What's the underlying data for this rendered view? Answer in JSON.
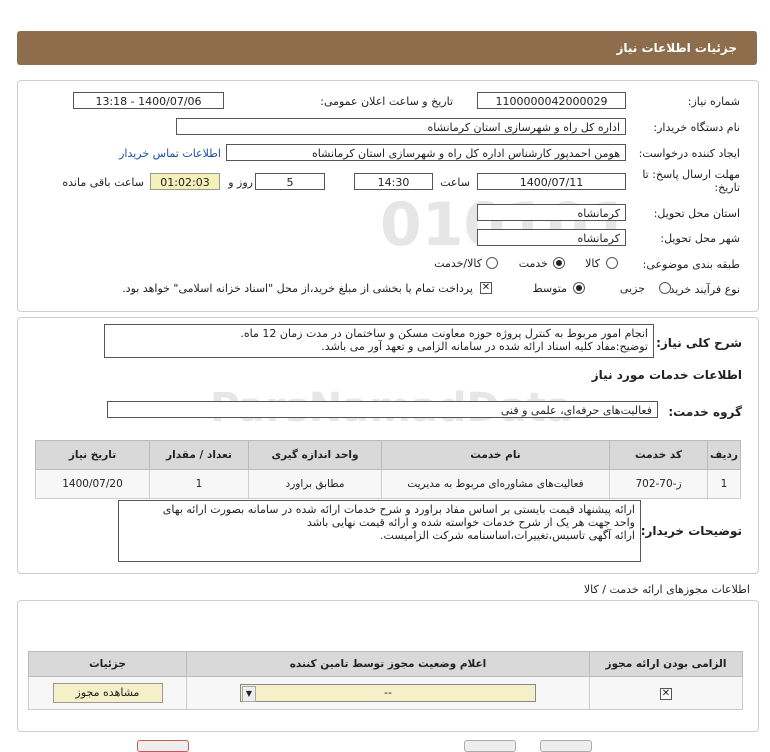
{
  "header": {
    "title": "جزئیات اطلاعات نیاز"
  },
  "form": {
    "need_number_label": "شماره نیاز:",
    "need_number": "1100000042000029",
    "announce_label": "تاریخ و ساعت اعلان عمومی:",
    "announce_value": "1400/07/06 - 13:18",
    "buyer_org_label": "نام دستگاه خریدار:",
    "buyer_org": "اداره کل راه و شهرسازی استان کرمانشاه",
    "creator_label": "ایجاد کننده درخواست:",
    "creator": "هومن احمدپور کارشناس اداره کل راه و شهرسازی استان کرمانشاه",
    "contact_link": "اطلاعات تماس خریدار",
    "deadline_label_1": "مهلت ارسال پاسخ: تا",
    "deadline_label_2": "تاریخ:",
    "deadline_date": "1400/07/11",
    "time_label": "ساعت",
    "deadline_time": "14:30",
    "days_value": "5",
    "days_label": "روز و",
    "remaining_time": "01:02:03",
    "remaining_label": "ساعت باقی مانده",
    "province_label": "استان محل تحویل:",
    "province": "کرمانشاه",
    "city_label": "شهر محل تحویل:",
    "city": "کرمانشاه",
    "category_label": "طبقه بندی موضوعی:",
    "category_options": [
      "کالا",
      "خدمت",
      "کالا/خدمت"
    ],
    "category_selected": "خدمت",
    "process_label": "نوع فرآیند خرید :",
    "process_options": [
      "جزیی",
      "متوسط"
    ],
    "process_selected": "متوسط",
    "payment_note": "پرداخت تمام یا بخشی از مبلغ خرید،از محل \"اسناد خزانه اسلامی\" خواهد بود."
  },
  "summary": {
    "label": "شرح کلی نیاز:",
    "line1": "انجام امور مربوط به کنترل پروژه حوزه معاونت مسکن و ساختمان در مدت زمان 12 ماه.",
    "line2": "توضیح:مفاد کلیه اسناد ارائه شده در سامانه الزامی و تعهد آور می باشد."
  },
  "services": {
    "section_title": "اطلاعات خدمات مورد نیاز",
    "group_label": "گروه خدمت:",
    "group_value": "فعالیت‌های حرفه‌ای، علمی و فنی",
    "columns": [
      "ردیف",
      "کد خدمت",
      "نام خدمت",
      "واحد اندازه گیری",
      "تعداد / مقدار",
      "تاریخ نیاز"
    ],
    "rows": [
      {
        "row": "1",
        "code": "ز-70-702",
        "name": "فعالیت‌های مشاوره‌ای مربوط به مدیریت",
        "unit": "مطابق براورد",
        "qty": "1",
        "date": "1400/07/20"
      }
    ]
  },
  "buyer_notes": {
    "label": "توضیحات خریدار:",
    "line1": "ارائه پیشنهاد قیمت بایستی بر اساس مفاد براورد و شرح خدمات ارائه شده در سامانه بصورت ارائه بهای",
    "line2": "واحد جهت هر یک از شرح خدمات خواسته شده و ارائه قیمت نهایی باشد",
    "line3": "ارائه آگهی تاسیس،تغییرات،اساسنامه شرکت الزامیست."
  },
  "licenses": {
    "section_title": "اطلاعات مجوزهای ارائه خدمت / کالا",
    "columns": [
      "الزامی بودن ارائه مجوز",
      "اعلام وضعیت مجوز توسط تامین کننده",
      "جزئیات"
    ],
    "status_value": "--",
    "view_button": "مشاهده مجوز"
  },
  "watermark": {
    "big": "ParsNamadData",
    "digits": "010101"
  },
  "colors": {
    "header": "#8e6d4c",
    "link": "#1a4fa8",
    "highlight": "#f5f0b8"
  }
}
